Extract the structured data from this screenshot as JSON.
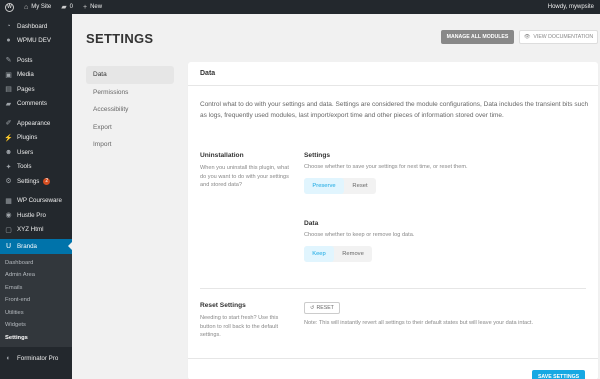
{
  "adminbar": {
    "site_label": "My Site",
    "comments_count": "0",
    "new_label": "New",
    "howdy": "Howdy, mywpsite"
  },
  "sidebar": {
    "top_items": [
      {
        "label": "Dashboard",
        "icon": "dashboard-icon"
      },
      {
        "label": "WPMU DEV",
        "icon": "wpmudev-icon"
      }
    ],
    "items": [
      {
        "label": "Posts",
        "icon": "pin-icon"
      },
      {
        "label": "Media",
        "icon": "media-icon"
      },
      {
        "label": "Pages",
        "icon": "pages-icon"
      },
      {
        "label": "Comments",
        "icon": "comment-icon"
      }
    ],
    "items2": [
      {
        "label": "Appearance",
        "icon": "brush-icon"
      },
      {
        "label": "Plugins",
        "icon": "plugin-icon"
      },
      {
        "label": "Users",
        "icon": "users-icon"
      },
      {
        "label": "Tools",
        "icon": "wrench-icon"
      },
      {
        "label": "Settings",
        "icon": "settings-icon",
        "badge": "2"
      }
    ],
    "items3": [
      {
        "label": "WP Courseware",
        "icon": "courseware-icon"
      },
      {
        "label": "Hustle Pro",
        "icon": "hustle-icon"
      },
      {
        "label": "XYZ Html",
        "icon": "xyz-icon"
      }
    ],
    "active": {
      "label": "Branda",
      "icon": "branda-icon"
    },
    "submenu": [
      "Dashboard",
      "Admin Area",
      "Emails",
      "Front-end",
      "Utilities",
      "Widgets",
      "Settings"
    ],
    "submenu_current": 6,
    "bottom": {
      "label": "Forminator Pro",
      "icon": "forminator-icon"
    }
  },
  "main": {
    "title": "SETTINGS",
    "manage_button": "MANAGE ALL MODULES",
    "docs_button": "VIEW DOCUMENTATION",
    "tabs": [
      "Data",
      "Permissions",
      "Accessibility",
      "Export",
      "Import"
    ],
    "active_tab": 0
  },
  "card": {
    "header": "Data",
    "intro": "Control what to do with your settings and data. Settings are considered the module configurations, Data includes the transient bits such as logs, frequently used modules, last import/export time and other pieces of information stored over time.",
    "uninstall": {
      "title": "Uninstallation",
      "desc": "When you uninstall this plugin, what do you want to do with your settings and stored data?",
      "settings_title": "Settings",
      "settings_desc": "Choose whether to save your settings for next time, or reset them.",
      "settings_options": [
        "Preserve",
        "Reset"
      ],
      "settings_selected": "Preserve",
      "data_title": "Data",
      "data_desc": "Choose whether to keep or remove log data.",
      "data_options": [
        "Keep",
        "Remove"
      ],
      "data_selected": "Keep"
    },
    "reset": {
      "title": "Reset Settings",
      "desc": "Needing to start fresh? Use this button to roll back to the default settings.",
      "button": "RESET",
      "note": "Note: This will instantly revert all settings to their default states but will leave your data intact."
    },
    "save_button": "SAVE SETTINGS"
  },
  "colors": {
    "admin_bar": "#23282d",
    "active_menu": "#0073aa",
    "accent": "#17a8e3",
    "badge": "#d54e21"
  }
}
